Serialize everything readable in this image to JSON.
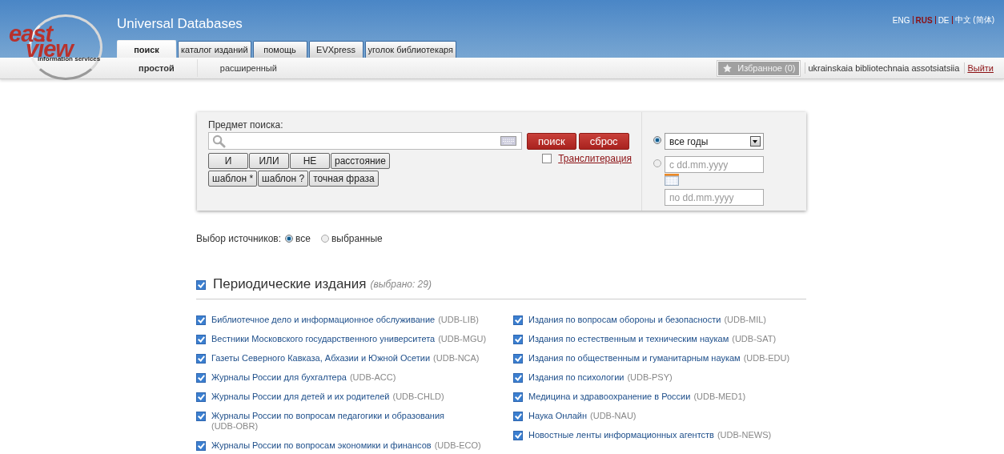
{
  "header": {
    "logo": {
      "word_1": "east",
      "word_2": "view",
      "tagline": "information services"
    },
    "title": "Universal Databases",
    "languages": [
      {
        "label": "ENG",
        "selected": false
      },
      {
        "label": "RUS",
        "selected": true
      },
      {
        "label": "DE",
        "selected": false
      },
      {
        "label": "中文 (简体)",
        "selected": false
      }
    ],
    "tabs": [
      {
        "label": "поиск",
        "selected": true
      },
      {
        "label": "каталог изданий",
        "selected": false
      },
      {
        "label": "помощь",
        "selected": false
      },
      {
        "label": "EVXpress",
        "selected": false
      },
      {
        "label": "уголок библиотекаря",
        "selected": false
      }
    ],
    "subtabs": [
      {
        "label": "простой",
        "selected": true
      },
      {
        "label": "расширенный",
        "selected": false
      }
    ],
    "favorites": "Избранное (0)",
    "user": "ukrainskaia bibliotechnaia assotsiatsiia",
    "logout": "Выйти"
  },
  "search": {
    "label": "Предмет поиска:",
    "buttons": [
      "поиск",
      "сброс"
    ],
    "operators": [
      [
        "И",
        "ИЛИ",
        "НЕ",
        "расстояние"
      ],
      [
        "шаблон *",
        "шаблон ?",
        "точная фраза"
      ]
    ],
    "transliteration": {
      "label": "Транслитерация",
      "checked": false
    },
    "dates": [
      {
        "kind": "select",
        "value": "все годы",
        "selected": true
      },
      {
        "kind": "range",
        "from_placeholder": "с dd.mm.yyyy",
        "to_placeholder": "по dd.mm.yyyy",
        "selected": false
      }
    ]
  },
  "sources": {
    "label": "Выбор источников:",
    "options": [
      {
        "label": "все",
        "selected": true
      },
      {
        "label": "выбранные",
        "selected": false
      }
    ]
  },
  "section": {
    "title": "Периодические издания",
    "count": "(выбрано: 29)",
    "checked": true
  },
  "columns": [
    [
      {
        "name": "Библиотечное дело и информационное обслуживание",
        "code": "(UDB-LIB)",
        "checked": true
      },
      {
        "name": "Вестники Московского государственного университета",
        "code": "(UDB-MGU)",
        "checked": true
      },
      {
        "name": "Газеты Северного Кавказа, Абхазии и Южной Осетии",
        "code": "(UDB-NCA)",
        "checked": true
      },
      {
        "name": "Журналы России для бухгалтера",
        "code": "(UDB-ACC)",
        "checked": true
      },
      {
        "name": "Журналы России для детей и их родителей",
        "code": "(UDB-CHLD)",
        "checked": true
      },
      {
        "name": "Журналы России по вопросам педагогики и образования",
        "code": "(UDB-OBR)",
        "checked": true
      },
      {
        "name": "Журналы России по вопросам экономики и финансов",
        "code": "(UDB-ECO)",
        "checked": true
      }
    ],
    [
      {
        "name": "Издания по вопросам обороны и безопасности",
        "code": "(UDB-MIL)",
        "checked": true
      },
      {
        "name": "Издания по естественным и техническим наукам",
        "code": "(UDB-SAT)",
        "checked": true
      },
      {
        "name": "Издания по общественным и гуманитарным наукам",
        "code": "(UDB-EDU)",
        "checked": true
      },
      {
        "name": "Издания по психологии",
        "code": "(UDB-PSY)",
        "checked": true
      },
      {
        "name": "Медицина и здравоохранение в России",
        "code": "(UDB-MED1)",
        "checked": true
      },
      {
        "name": "Наука Онлайн",
        "code": "(UDB-NAU)",
        "checked": true
      },
      {
        "name": "Новостные ленты информационных агентств",
        "code": "(UDB-NEWS)",
        "checked": true
      }
    ]
  ]
}
